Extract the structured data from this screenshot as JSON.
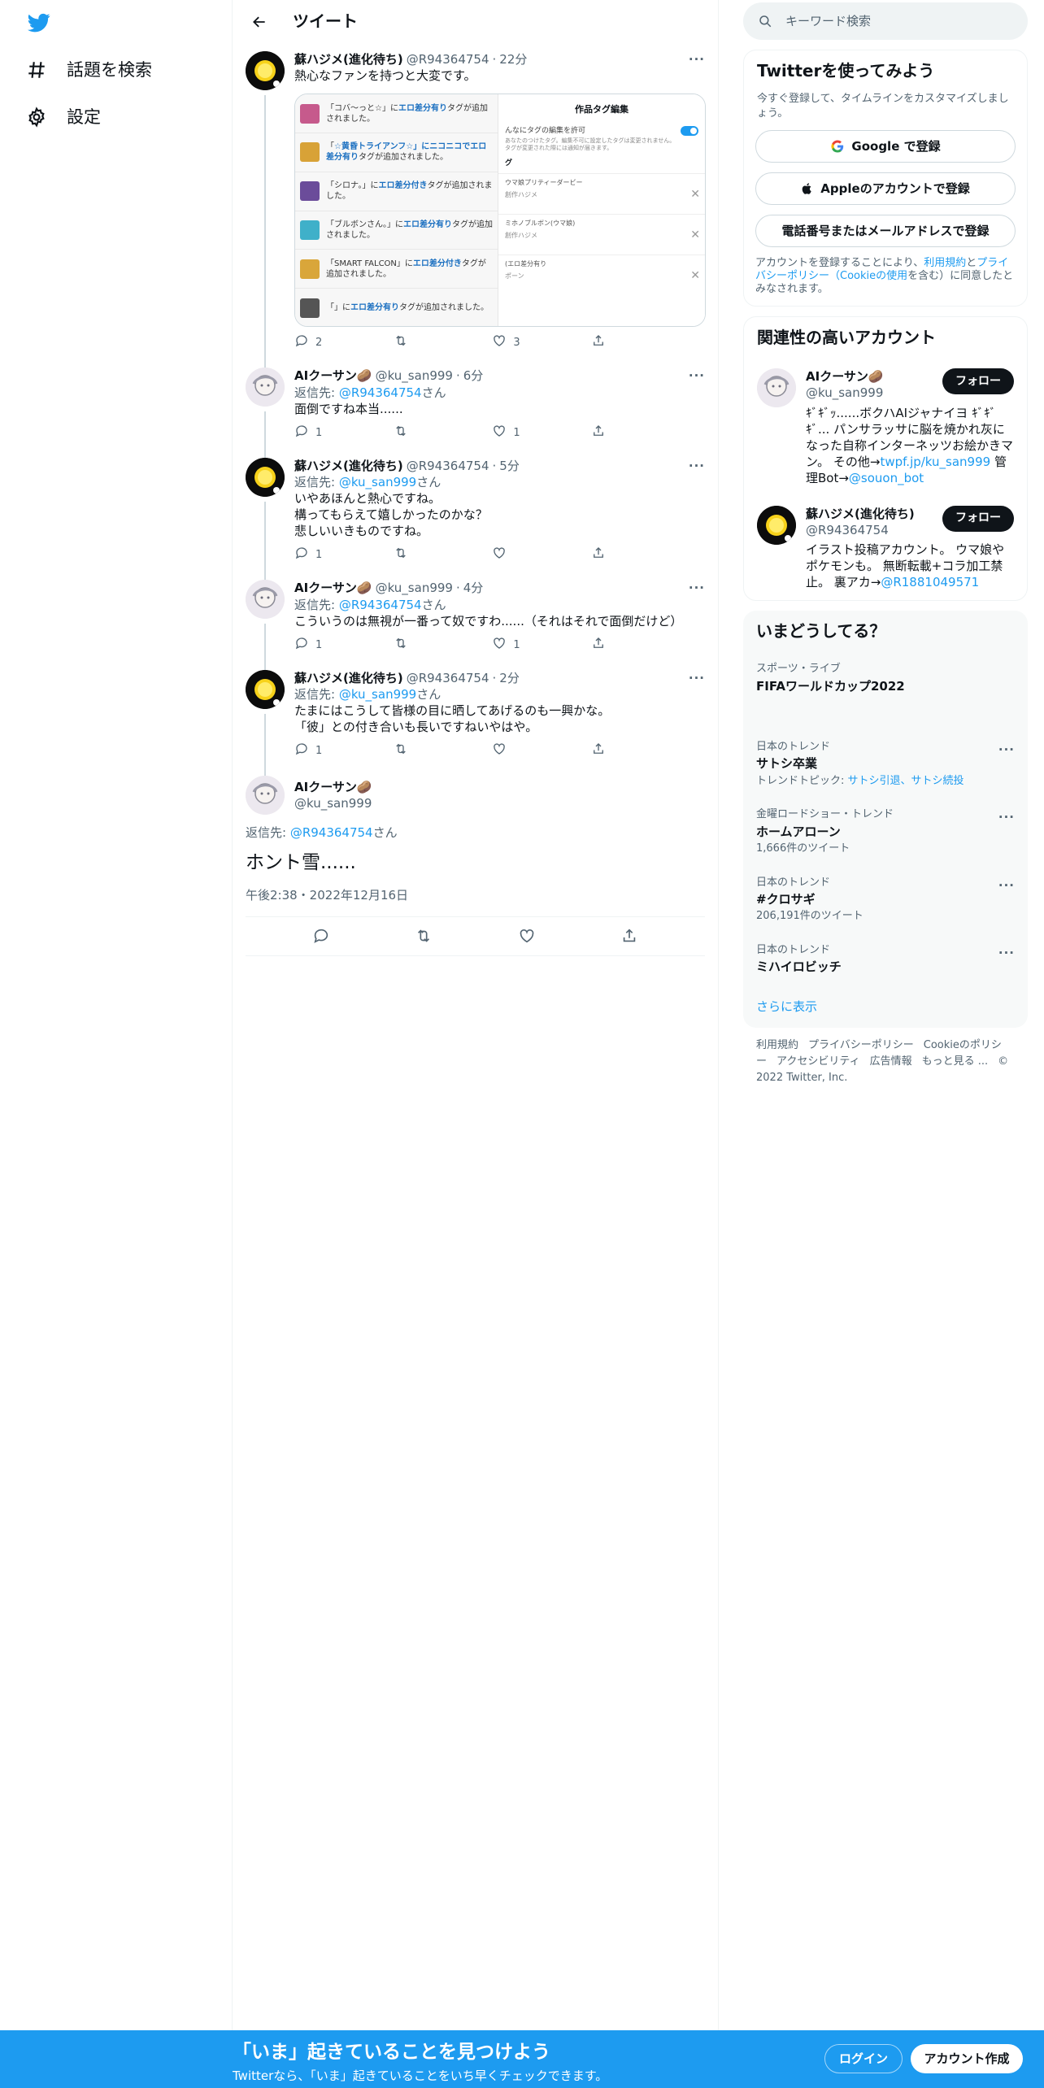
{
  "nav": {
    "explore": "話題を検索",
    "settings": "設定"
  },
  "header": {
    "title": "ツイート"
  },
  "tweets": [
    {
      "name": "蘇ハジメ(進化待ち)",
      "handle": "@R94364754",
      "time": "22分",
      "text": "熱心なファンを持つと大変です。",
      "reply_to": null,
      "counts": {
        "reply": "2",
        "retweet": "",
        "like": "3"
      }
    },
    {
      "name": "AIクーサン🥔",
      "handle": "@ku_san999",
      "time": "6分",
      "reply_to": "@R94364754",
      "text": "面倒ですね本当......",
      "counts": {
        "reply": "1",
        "retweet": "",
        "like": "1"
      }
    },
    {
      "name": "蘇ハジメ(進化待ち)",
      "handle": "@R94364754",
      "time": "5分",
      "reply_to": "@ku_san999",
      "text": "いやあほんと熱心ですね。\n構ってもらえて嬉しかったのかな？\n悲しいいきものですね。",
      "counts": {
        "reply": "1",
        "retweet": "",
        "like": ""
      }
    },
    {
      "name": "AIクーサン🥔",
      "handle": "@ku_san999",
      "time": "4分",
      "reply_to": "@R94364754",
      "text": "こういうのは無視が一番って奴ですわ......（それはそれで面倒だけど）",
      "counts": {
        "reply": "1",
        "retweet": "",
        "like": "1"
      }
    },
    {
      "name": "蘇ハジメ(進化待ち)",
      "handle": "@R94364754",
      "time": "2分",
      "reply_to": "@ku_san999",
      "text": "たまにはこうして皆様の目に晒してあげるのも一興かな。\n「彼」との付き合いも長いですねいやはや。",
      "counts": {
        "reply": "1",
        "retweet": "",
        "like": ""
      }
    }
  ],
  "reply_prefix": "返信先: ",
  "reply_suffix": "さん",
  "media": {
    "notifications": [
      {
        "pre": "「コバ〜っと☆」に",
        "tag": "エロ差分有り",
        "post": "タグが追加されました。",
        "color": "#c65a8c"
      },
      {
        "pre": "「",
        "tag": "☆黄昏トライアンフ☆」にニコニコでエロ差分有り",
        "post": "タグが追加されました。",
        "color": "#d8a237"
      },
      {
        "pre": "「シロナ。」に",
        "tag": "エロ差分付き",
        "post": "タグが追加されました。",
        "color": "#6b4c9a"
      },
      {
        "pre": "「ブルボンさん。」に",
        "tag": "エロ差分有り",
        "post": "タグが追加されました。",
        "color": "#3fb0c9"
      },
      {
        "pre": "「SMART FALCON」に",
        "tag": "エロ差分付き",
        "post": "タグが追加されました。",
        "color": "#d9a63a"
      },
      {
        "pre": "「」に",
        "tag": "エロ差分有り",
        "post": "タグが追加されました。",
        "color": "#555555"
      }
    ],
    "panel_title": "作品タグ編集",
    "panel_toggle": "んなにタグの編集を許可",
    "panel_note": "あなたのつけたタグ。編集不可に設定したタグは変更されません。\nタグが変更された際には通知が届きます。",
    "panel_section": "グ",
    "panel_rows": [
      {
        "label": "ウマ娘プリティーダービー",
        "sub": "創作ハジメ"
      },
      {
        "label": "ミホノブルボン(ウマ娘)",
        "sub": "創作ハジメ"
      },
      {
        "label": "(エロ差分有り",
        "sub": "ポーン"
      }
    ]
  },
  "focal": {
    "name": "AIクーサン🥔",
    "handle": "@ku_san999",
    "reply_to": "@R94364754",
    "text": "ホント雪......",
    "timestamp": "午後2:38・2022年12月16日"
  },
  "right": {
    "search_placeholder": "キーワード検索",
    "signup_title": "Twitterを使ってみよう",
    "signup_sub": "今すぐ登録して、タイムラインをカスタマイズしましょう。",
    "google_btn": "Google で登録",
    "apple_btn": "Appleのアカウントで登録",
    "phone_btn": "電話番号またはメールアドレスで登録",
    "terms_pre": "アカウントを登録することにより、",
    "terms_link1": "利用規約",
    "terms_mid": "と",
    "terms_link2": "プライバシーポリシー（Cookieの使用",
    "terms_post": "を含む）に同意したとみなされます。",
    "related_title": "関連性の高いアカウント",
    "accounts": [
      {
        "name": "AIクーサン🥔",
        "handle": "@ku_san999",
        "bio": "ｷﾞｷﾞｯ......ボクハAIジャナイヨ ｷﾞｷﾞｷﾞ... パンサラッサに脳を焼かれ灰になった自称インターネッツお絵かきマン。 その他→",
        "link": "twpf.jp/ku_san999",
        "bio2": " 管理Bot→",
        "link2": "@souon_bot",
        "follow": "フォロー"
      },
      {
        "name": "蘇ハジメ(進化待ち)",
        "handle": "@R94364754",
        "bio": "イラスト投稿アカウント。 ウマ娘やポケモンも。 無断転載+コラ加工禁止。 裏アカ→",
        "link": "@R1881049571",
        "bio2": "",
        "link2": "",
        "follow": "フォロー"
      }
    ],
    "trends_title": "いまどうしてる？",
    "trends": [
      {
        "ctx": "スポーツ・ライブ",
        "title": "FIFAワールドカップ2022",
        "sub": "",
        "topic_pre": "",
        "topic": ""
      },
      {
        "ctx": "日本のトレンド",
        "title": "サトシ卒業",
        "sub": "",
        "topic_pre": "トレンドトピック: ",
        "topic": "サトシ引退、サトシ続投"
      },
      {
        "ctx": "金曜ロードショー・トレンド",
        "title": "ホームアローン",
        "sub": "1,666件のツイート",
        "topic_pre": "",
        "topic": ""
      },
      {
        "ctx": "日本のトレンド",
        "title": "#クロサギ",
        "sub": "206,191件のツイート",
        "topic_pre": "",
        "topic": ""
      },
      {
        "ctx": "日本のトレンド",
        "title": "ミハイロビッチ",
        "sub": "",
        "topic_pre": "",
        "topic": ""
      }
    ],
    "show_more": "さらに表示",
    "footer": [
      "利用規約",
      "プライバシーポリシー",
      "Cookieのポリシー",
      "アクセシビリティ",
      "広告情報",
      "もっと見る ...",
      "© 2022 Twitter, Inc."
    ]
  },
  "bottom": {
    "title": "「いま」起きていることを見つけよう",
    "sub": "Twitterなら、「いま」起きていることをいち早くチェックできます。",
    "login": "ログイン",
    "signup": "アカウント作成"
  },
  "colors": {
    "accent": "#1d9bf0",
    "text": "#0f1419",
    "muted": "#536471"
  }
}
